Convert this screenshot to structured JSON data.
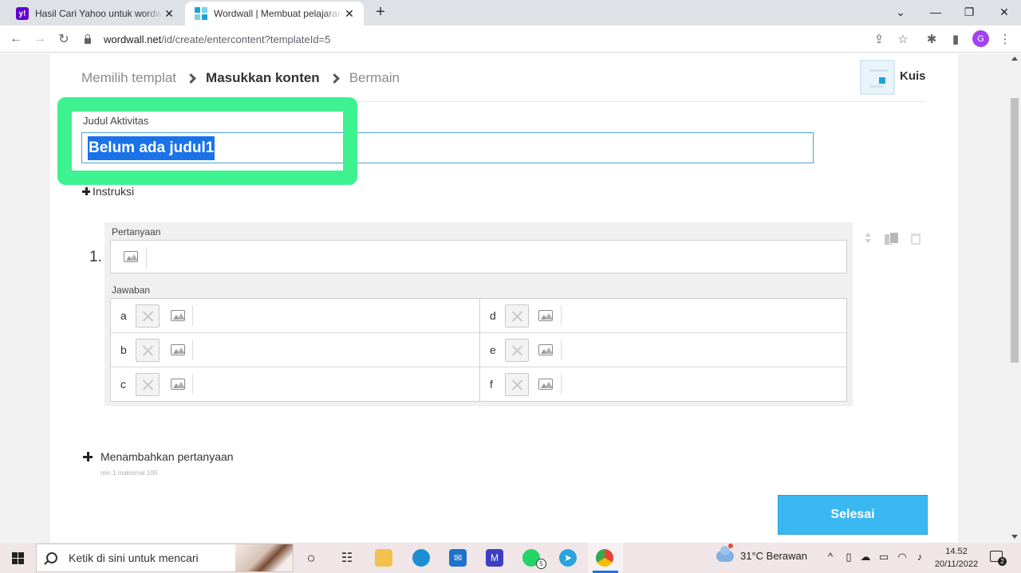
{
  "browser": {
    "tabs": [
      {
        "title": "Hasil Cari Yahoo untuk wordwall",
        "favicon": "yahoo-icon",
        "active": false
      },
      {
        "title": "Wordwall | Membuat pelajaran yang lebih baik",
        "favicon": "wordwall-icon",
        "active": true
      }
    ],
    "url_host": "wordwall.net",
    "url_path": "/id/create/entercontent?templateId=5",
    "profile_initial": "G",
    "accent_color": "#a142f4"
  },
  "breadcrumb": {
    "step1": "Memilih templat",
    "step2": "Masukkan konten",
    "step3": "Bermain"
  },
  "template": {
    "name": "Kuis"
  },
  "activity": {
    "title_label": "Judul Aktivitas",
    "title_value": "Belum ada judul1",
    "instructions_label": "Instruksi"
  },
  "question": {
    "number": "1.",
    "question_label": "Pertanyaan",
    "answers_label": "Jawaban",
    "answers": [
      {
        "letter": "a"
      },
      {
        "letter": "b"
      },
      {
        "letter": "c"
      },
      {
        "letter": "d"
      },
      {
        "letter": "e"
      },
      {
        "letter": "f"
      }
    ]
  },
  "add_question": {
    "label": "Menambahkan pertanyaan",
    "limits": "min 1   maksimal 100"
  },
  "done_button": {
    "label": "Selesai",
    "color": "#3ab8f2"
  },
  "highlight_color": "#3ef290",
  "taskbar": {
    "search_placeholder": "Ketik di sini untuk mencari",
    "whatsapp_badge": "5",
    "weather": "31°C  Berawan",
    "time": "14.52",
    "date": "20/11/2022",
    "notification_count": "2"
  }
}
